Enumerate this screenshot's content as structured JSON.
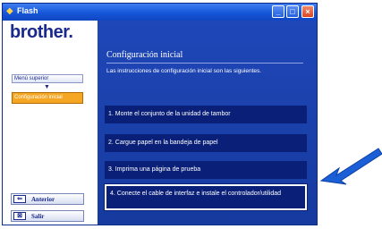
{
  "window": {
    "title": "Flash",
    "logo": "brother."
  },
  "sidebar": {
    "items": [
      {
        "label": "Menú superior"
      },
      {
        "label": "Configuración inicial"
      }
    ],
    "buttons": {
      "previous": "Anterior",
      "exit": "Salir"
    }
  },
  "main": {
    "title": "Configuración inicial",
    "description": "Las instrucciones de configuración inicial son las siguientes.",
    "steps": [
      {
        "label": "1. Monte el conjunto de la unidad de tambor"
      },
      {
        "label": "2. Cargue papel en la bandeja de papel"
      },
      {
        "label": "3. Imprima una página de prueba"
      },
      {
        "label": "4. Conecte el cable de interfaz e instale el controlador/utilidad"
      }
    ]
  },
  "colors": {
    "accent": "#f5a623",
    "panel": "#1f47b8",
    "pointer": "#1a5fd6"
  }
}
